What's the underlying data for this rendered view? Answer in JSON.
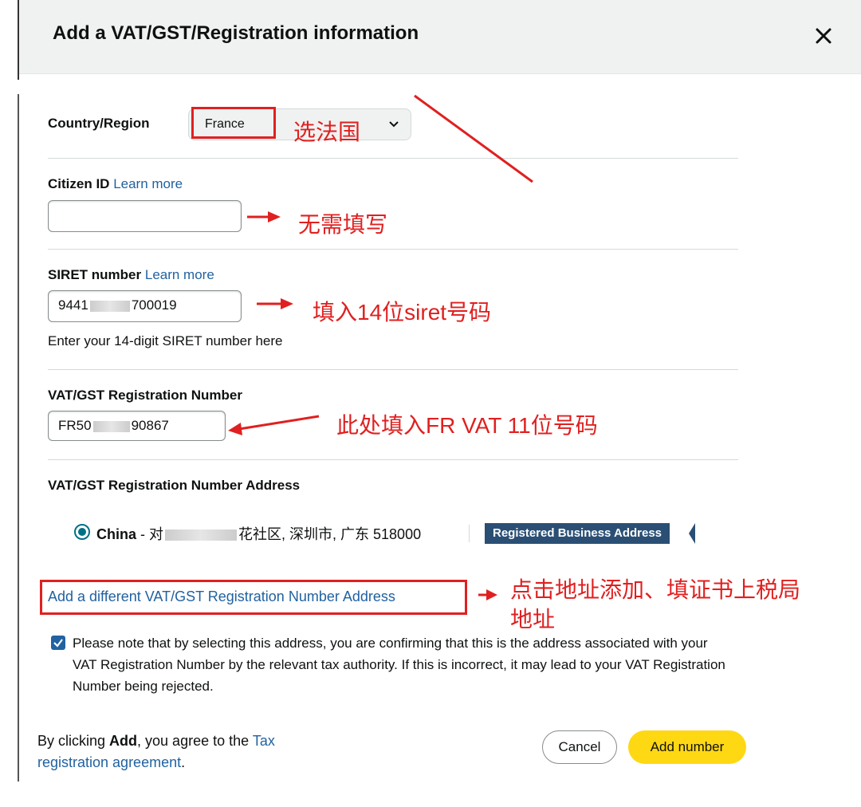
{
  "modal": {
    "title": "Add a VAT/GST/Registration information",
    "close_icon": "close-icon"
  },
  "country": {
    "label": "Country/Region",
    "value": "France"
  },
  "citizen_id": {
    "label": "Citizen ID",
    "learn_more": "Learn more",
    "value": ""
  },
  "siret": {
    "label": "SIRET number",
    "learn_more": "Learn more",
    "value_prefix": "9441",
    "value_suffix": "700019",
    "hint": "Enter your 14-digit SIRET number here"
  },
  "vat": {
    "label": "VAT/GST Registration Number",
    "value_prefix": "FR50",
    "value_suffix": "90867"
  },
  "vat_address": {
    "label": "VAT/GST Registration Number Address",
    "country": "China",
    "dash": " - ",
    "first_char": "对",
    "address_visible": "花社区, 深圳市, 广东 518000",
    "badge": "Registered Business Address",
    "add_link": "Add a different VAT/GST Registration Number Address"
  },
  "confirmation": {
    "checked": true,
    "text": "Please note that by selecting this address, you are confirming that this is the address associated with your VAT Registration Number by the relevant tax authority. If this is incorrect, it may lead to your VAT Registration Number being rejected."
  },
  "footer": {
    "agree_prefix": "By clicking ",
    "agree_bold": "Add",
    "agree_middle": ", you agree to the ",
    "agreement_link": "Tax registration agreement",
    "agree_end": ".",
    "cancel_label": "Cancel",
    "add_label": "Add number"
  },
  "annotations": {
    "select_france": "选法国",
    "no_need": "无需填写",
    "fill_siret": "填入14位siret号码",
    "fill_vat": "此处填入FR VAT 11位号码",
    "click_address_line1": "点击地址添加、填证书上税局",
    "click_address_line2": "地址",
    "color": "#e02020"
  },
  "colors": {
    "link": "#2162a1",
    "primary_button": "#ffd814",
    "badge": "#2b4f74",
    "radio": "#007185"
  }
}
